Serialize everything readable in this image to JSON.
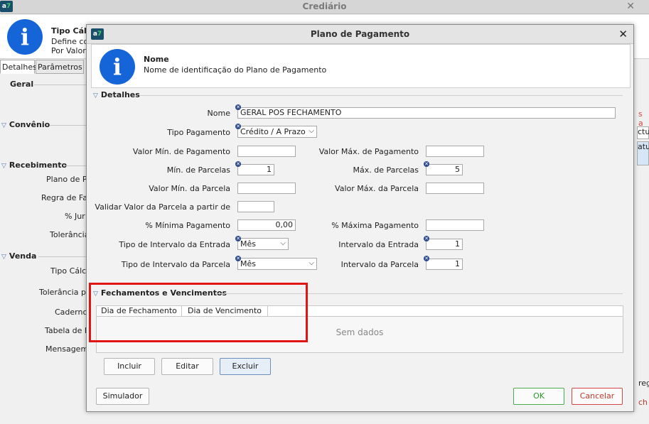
{
  "bg": {
    "title": "Crediário",
    "header_title": "Tipo Cálc",
    "header_line1": "Define co",
    "header_line2": "Por Valor",
    "tabs": [
      "Detalhes",
      "Parâmetros"
    ],
    "sections": {
      "geral": "Geral",
      "convenio": "Convênio",
      "recebimento": "Recebimento",
      "venda": "Venda"
    },
    "labels": {
      "plano": "Plano de P",
      "regra": "Regra de Fa",
      "juros": "% Jur",
      "tolerancia": "Tolerância",
      "tipo_calc": "Tipo Cálc",
      "tolerancia_p": "Tolerância p",
      "caderno": "Caderno",
      "tabela": "Tabela de F",
      "mensagem": "Mensagem"
    },
    "right_labels": [
      "s a",
      "ctu",
      "atu",
      "reg",
      "ch"
    ]
  },
  "modal": {
    "title": "Plano de Pagamento",
    "header_title": "Nome",
    "header_subtitle": "Nome de identificação do Plano de Pagamento",
    "section_detalhes": "Detalhes",
    "section_fechamentos": "Fechamentos e Vencimentos",
    "labels": {
      "nome": "Nome",
      "tipo_pagamento": "Tipo Pagamento",
      "valor_min_pag": "Valor Mín. de Pagamento",
      "valor_max_pag": "Valor Máx. de Pagamento",
      "min_parcelas": "Mín. de Parcelas",
      "max_parcelas": "Máx. de Parcelas",
      "valor_min_parcela": "Valor Mín. da Parcela",
      "valor_max_parcela": "Valor Máx. da Parcela",
      "validar_valor": "Validar Valor da Parcela a partir de",
      "pct_min_pag": "% Mínima Pagamento",
      "pct_max_pag": "% Máxima Pagamento",
      "tipo_int_entrada": "Tipo de Intervalo da Entrada",
      "int_entrada": "Intervalo da Entrada",
      "tipo_int_parcela": "Tipo de Intervalo da Parcela",
      "int_parcela": "Intervalo da Parcela"
    },
    "values": {
      "nome": "GERAL POS FECHAMENTO",
      "tipo_pagamento": "Crédito / A Prazo",
      "valor_min_pag": "",
      "valor_max_pag": "",
      "min_parcelas": "1",
      "max_parcelas": "5",
      "valor_min_parcela": "",
      "valor_max_parcela": "",
      "validar_valor": "",
      "pct_min_pag": "0,00",
      "pct_max_pag": "",
      "tipo_int_entrada": "Mês",
      "int_entrada": "1",
      "tipo_int_parcela": "Mês",
      "int_parcela": "1"
    },
    "table": {
      "columns": [
        "Dia de Fechamento",
        "Dia de Vencimento"
      ],
      "empty_text": "Sem dados"
    },
    "buttons": {
      "incluir": "Incluir",
      "editar": "Editar",
      "excluir": "Excluir",
      "simulador": "Simulador",
      "ok": "OK",
      "cancelar": "Cancelar"
    },
    "highlight_color": "#e31414"
  }
}
